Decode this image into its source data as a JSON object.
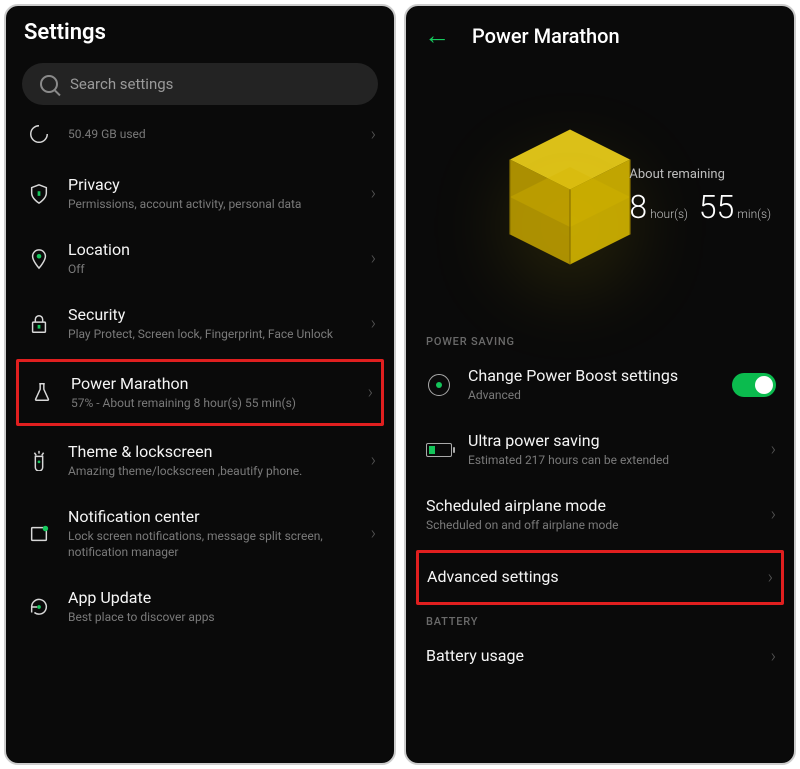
{
  "left": {
    "title": "Settings",
    "search_placeholder": "Search settings",
    "items": [
      {
        "icon": "storage",
        "title": "",
        "sub": "50.49 GB used"
      },
      {
        "icon": "privacy",
        "title": "Privacy",
        "sub": "Permissions, account activity, personal data"
      },
      {
        "icon": "location",
        "title": "Location",
        "sub": "Off"
      },
      {
        "icon": "security",
        "title": "Security",
        "sub": "Play Protect, Screen lock, Fingerprint, Face Unlock"
      },
      {
        "icon": "flask",
        "title": "Power Marathon",
        "sub": "57% - About remaining 8 hour(s)  55 min(s)",
        "hilite": true
      },
      {
        "icon": "theme",
        "title": "Theme & lockscreen",
        "sub": "Amazing theme/lockscreen ,beautify phone."
      },
      {
        "icon": "notif",
        "title": "Notification center",
        "sub": "Lock screen notifications, message split screen, notification manager"
      },
      {
        "icon": "update",
        "title": "App Update",
        "sub": "Best place to discover apps"
      }
    ]
  },
  "right": {
    "title": "Power Marathon",
    "remain_label": "About remaining",
    "remain_h": "8",
    "remain_hu": "hour(s)",
    "remain_m": "55",
    "remain_mu": "min(s)",
    "sect1": "POWER SAVING",
    "items": [
      {
        "icon": "pboost",
        "title": "Change Power Boost settings",
        "sub": "Advanced",
        "toggle": true
      },
      {
        "icon": "batt",
        "title": "Ultra power saving",
        "sub": "Estimated 217 hours can be extended"
      },
      {
        "title": "Scheduled airplane mode",
        "sub": "Scheduled on and off airplane mode"
      },
      {
        "title": "Advanced settings",
        "hilite": true
      }
    ],
    "sect2": "BATTERY",
    "items2": [
      {
        "title": "Battery usage"
      }
    ]
  }
}
